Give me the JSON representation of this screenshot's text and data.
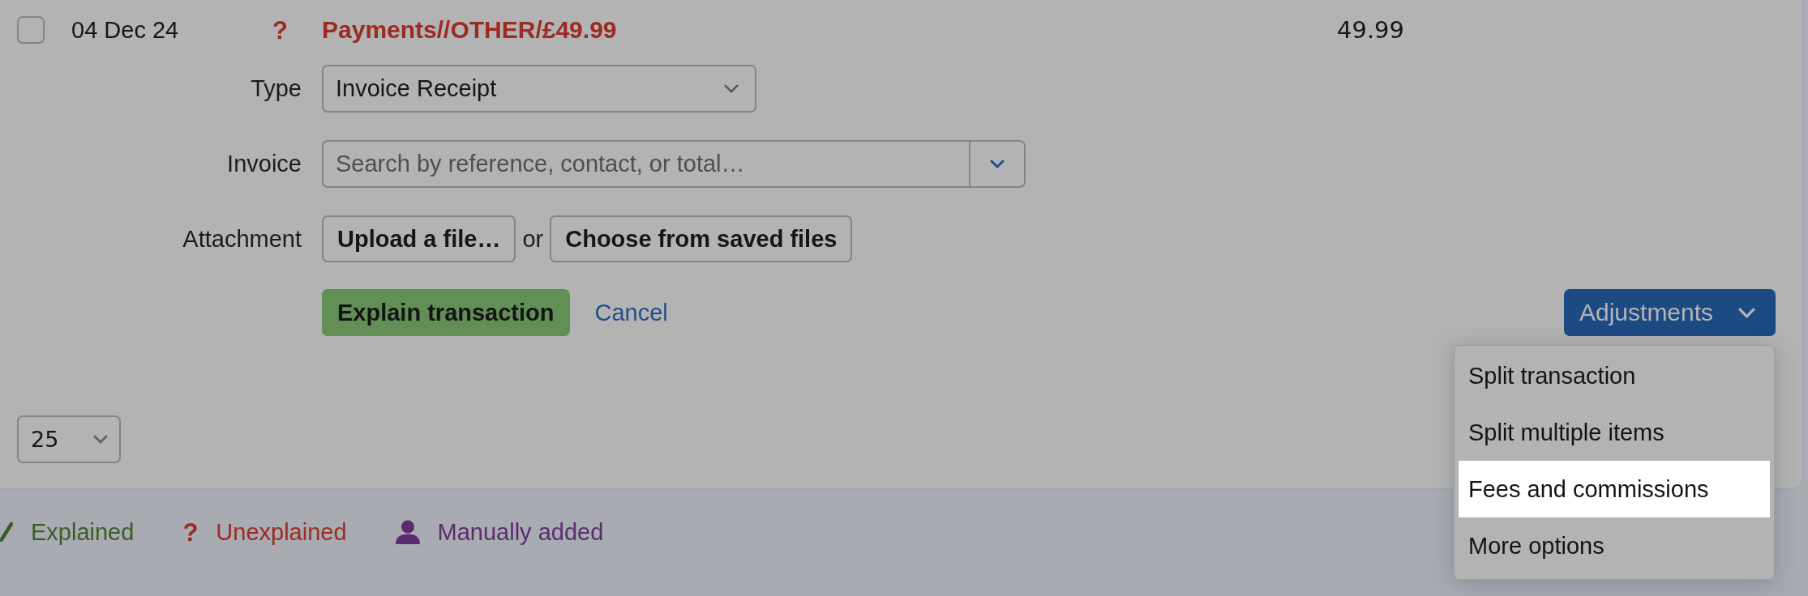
{
  "transaction": {
    "checked": false,
    "date": "04 Dec 24",
    "status_symbol": "?",
    "description": "Payments//OTHER/£49.99",
    "amount": "49.99"
  },
  "explain_form": {
    "type_field": {
      "label": "Type",
      "value": "Invoice Receipt"
    },
    "invoice_field": {
      "label": "Invoice",
      "placeholder": "Search by reference, contact, or total…"
    },
    "attachment": {
      "label": "Attachment",
      "upload_button": "Upload a file…",
      "separator": "or",
      "saved_files_button": "Choose from saved files"
    },
    "submit_button": "Explain transaction",
    "cancel_link": "Cancel"
  },
  "adjustments": {
    "label": "Adjustments",
    "expanded": true,
    "menu": [
      {
        "label": "Split transaction",
        "selected": false
      },
      {
        "label": "Split multiple items",
        "selected": false
      },
      {
        "label": "Fees and commissions",
        "selected": true
      },
      {
        "label": "More options",
        "selected": false
      }
    ]
  },
  "page_size": {
    "value": "25"
  },
  "legend": [
    {
      "kind": "explained",
      "label": "Explained",
      "color": "#3b5d28"
    },
    {
      "kind": "unexplained",
      "symbol": "?",
      "label": "Unexplained",
      "color": "#9c2b22"
    },
    {
      "kind": "manual",
      "label": "Manually added",
      "color": "#5b2c6f"
    }
  ]
}
